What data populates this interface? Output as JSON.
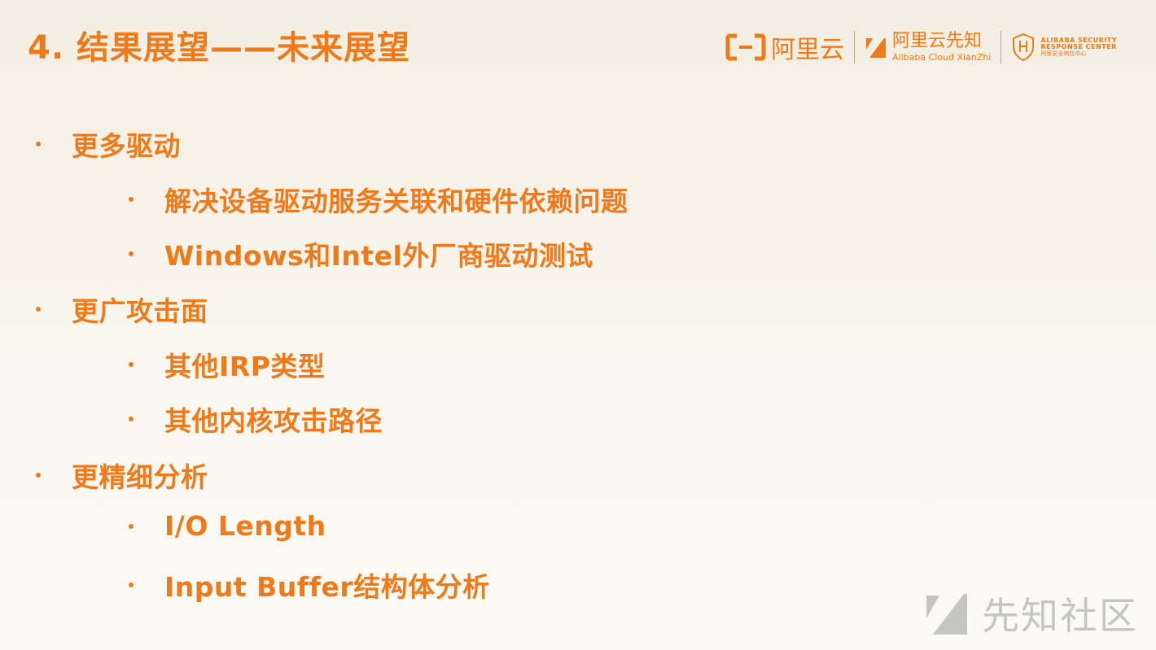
{
  "slide": {
    "title": "4. 结果展望——未来展望"
  },
  "logos": {
    "aliyun": "阿里云",
    "xianzhi_cn": "阿里云先知",
    "xianzhi_en": "Alibaba Cloud XianZhi",
    "asrc_line1": "ALIBABA SECURITY",
    "asrc_line2": "RESPONSE CENTER",
    "asrc_cn": "阿里安全响应中心"
  },
  "sections": [
    {
      "label": "更多驱动",
      "items": [
        "解决设备驱动服务关联和硬件依赖问题",
        "Windows和Intel外厂商驱动测试"
      ]
    },
    {
      "label": "更广攻击面",
      "items": [
        "其他IRP类型",
        "其他内核攻击路径"
      ]
    },
    {
      "label": "更精细分析",
      "items": [
        "I/O Length",
        "Input Buffer结构体分析"
      ]
    }
  ],
  "watermark": {
    "text": "先知社区"
  },
  "colors": {
    "accent": "#ef7a1a",
    "watermark": "#9a9a9a"
  }
}
